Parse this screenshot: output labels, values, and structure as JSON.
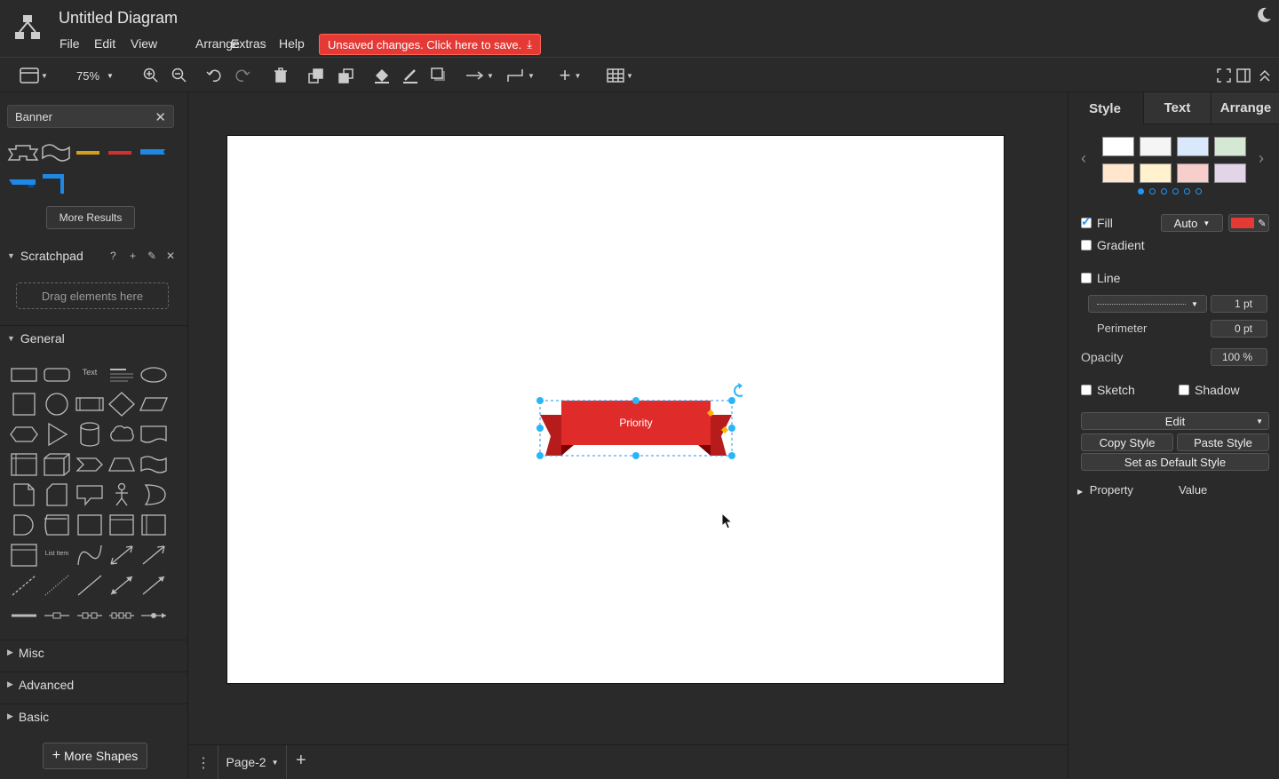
{
  "app": {
    "title": "Untitled Diagram",
    "unsaved_label": "Unsaved changes. Click here to save."
  },
  "menu": [
    "File",
    "Edit",
    "View",
    "Arrange",
    "Extras",
    "Help"
  ],
  "toolbar": {
    "zoom_value": "75%",
    "page_label": "Page-2"
  },
  "left": {
    "search_value": "Banner",
    "more_results_label": "More Results",
    "scratchpad_label": "Scratchpad",
    "drag_label": "Drag elements here",
    "general_label": "General",
    "misc_label": "Misc",
    "advanced_label": "Advanced",
    "basic_label": "Basic",
    "more_shapes_label": "More Shapes",
    "text_shape_label": "Text",
    "list_item_label": "List Item"
  },
  "canvas": {
    "banner_text": "Priority",
    "banner_color": "#e02b2b"
  },
  "right": {
    "tabs": [
      "Style",
      "Text",
      "Arrange"
    ],
    "swatches_row1": [
      "#ffffff",
      "#f5f5f5",
      "#dae8fc",
      "#d5e8d4"
    ],
    "swatches_row2": [
      "#ffe6cc",
      "#fff2cc",
      "#f8cecc",
      "#e1d5e7"
    ],
    "fill_label": "Fill",
    "fill_mode": "Auto",
    "fill_color": "#e53935",
    "gradient_label": "Gradient",
    "line_label": "Line",
    "line_width": "1 pt",
    "perimeter_label": "Perimeter",
    "perimeter_value": "0 pt",
    "opacity_label": "Opacity",
    "opacity_value": "100 %",
    "sketch_label": "Sketch",
    "shadow_label": "Shadow",
    "edit_label": "Edit",
    "copy_style_label": "Copy Style",
    "paste_style_label": "Paste Style",
    "default_style_label": "Set as Default Style",
    "property_label": "Property",
    "value_label": "Value"
  }
}
